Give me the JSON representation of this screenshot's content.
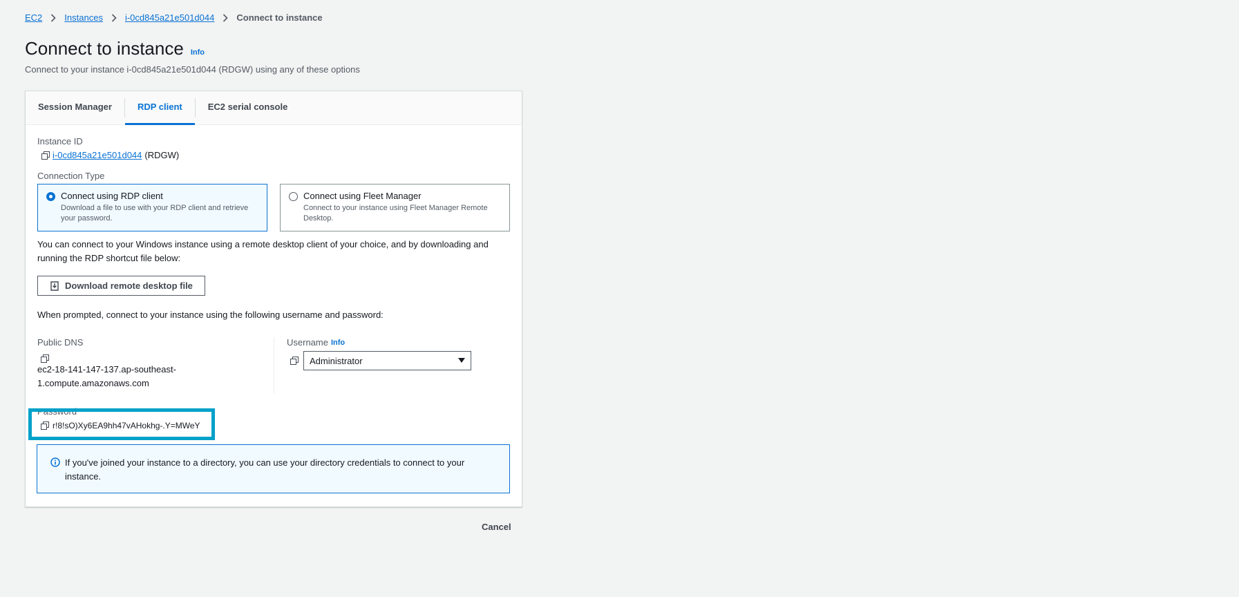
{
  "breadcrumb": {
    "items": [
      "EC2",
      "Instances",
      "i-0cd845a21e501d044"
    ],
    "current": "Connect to instance"
  },
  "page": {
    "title": "Connect to instance",
    "title_info": "Info",
    "subtitle": "Connect to your instance i-0cd845a21e501d044 (RDGW) using any of these options"
  },
  "tabs": [
    "Session Manager",
    "RDP client",
    "EC2 serial console"
  ],
  "instance": {
    "label": "Instance ID",
    "id": "i-0cd845a21e501d044",
    "name": "(RDGW)"
  },
  "connection_type": {
    "label": "Connection Type",
    "options": [
      {
        "title": "Connect using RDP client",
        "desc": "Download a file to use with your RDP client and retrieve your password."
      },
      {
        "title": "Connect using Fleet Manager",
        "desc": "Connect to your instance using Fleet Manager Remote Desktop."
      }
    ]
  },
  "rdp": {
    "intro": "You can connect to your Windows instance using a remote desktop client of your choice, and by downloading and running the RDP shortcut file below:",
    "download_label": "Download remote desktop file",
    "prompt": "When prompted, connect to your instance using the following username and password:"
  },
  "public_dns": {
    "label": "Public DNS",
    "line1": "ec2-18-141-147-137.ap-southeast-",
    "line2": "1.compute.amazonaws.com"
  },
  "username": {
    "label": "Username",
    "info": "Info",
    "value": "Administrator"
  },
  "password": {
    "label": "Password",
    "value": "r!8!sO)Xy6EA9hh47vAHokhg-.Y=MWeY"
  },
  "alert": {
    "text": "If you've joined your instance to a directory, you can use your directory credentials to connect to your instance."
  },
  "footer": {
    "cancel_label": "Cancel"
  },
  "colors": {
    "accent": "#0972d3",
    "highlight": "#00a1c9",
    "background": "#f2f3f3"
  }
}
